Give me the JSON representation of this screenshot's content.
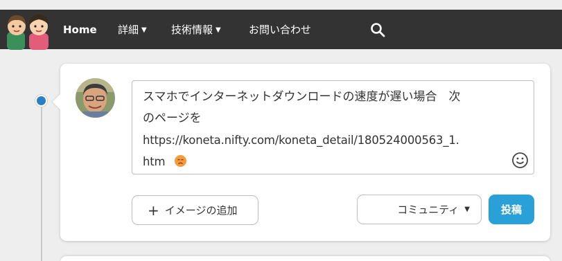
{
  "nav": {
    "logo": "family-logo-icon",
    "home": "Home",
    "detail": "詳細",
    "tech": "技術情報",
    "contact": "お問い合わせ",
    "caret": "▼"
  },
  "post": {
    "text_line1": "スマホでインターネットダウンロードの速度が遅い場合　次",
    "text_line2": "のページを",
    "text_line3": "https://koneta.nifty.com/koneta_detail/180524000563_1.",
    "text_line4": "htm",
    "emoji": "sad-face-emoji"
  },
  "actions": {
    "add_image_plus": "+",
    "add_image": "イメージの追加",
    "community": "コミュニティ",
    "community_caret": "▼",
    "submit": "投稿"
  },
  "colors": {
    "navbar": "#333333",
    "accent": "#2aa0d8",
    "timeline_dot": "#2b7fc4"
  }
}
